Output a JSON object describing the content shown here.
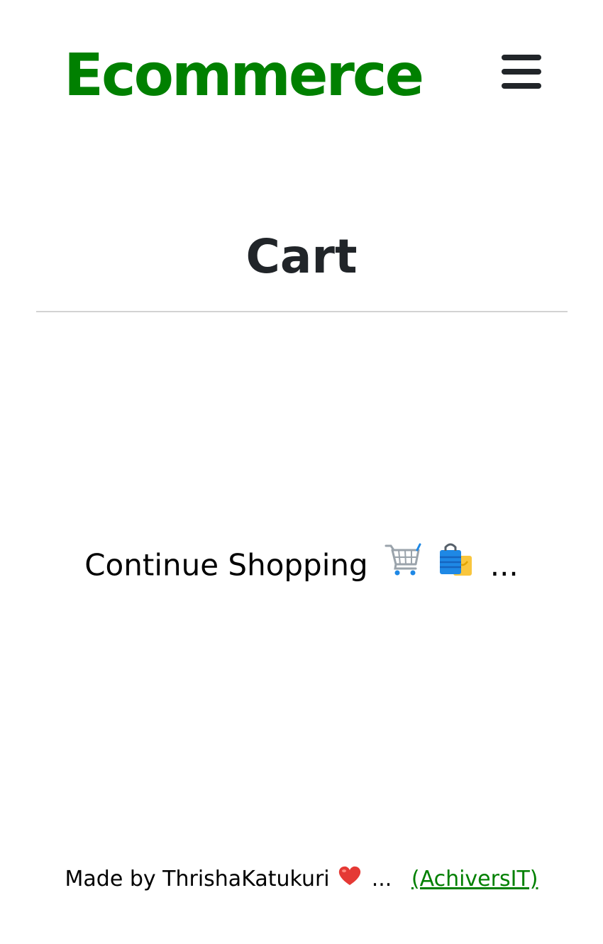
{
  "navbar": {
    "brand": "Ecommerce",
    "menu_icon": "hamburger-menu-icon",
    "brand_color": "#008000"
  },
  "main": {
    "title": "Cart",
    "continue_label": "Continue Shopping",
    "continue_icons": [
      "shopping-cart-icon",
      "shopping-bags-icon"
    ],
    "continue_suffix": "..."
  },
  "footer": {
    "made_by": "Made by ThrishaKatukuri",
    "heart_icon": "red-heart-icon",
    "suffix": "...",
    "link_text": "(AchiversIT)",
    "link_color": "#008000"
  }
}
